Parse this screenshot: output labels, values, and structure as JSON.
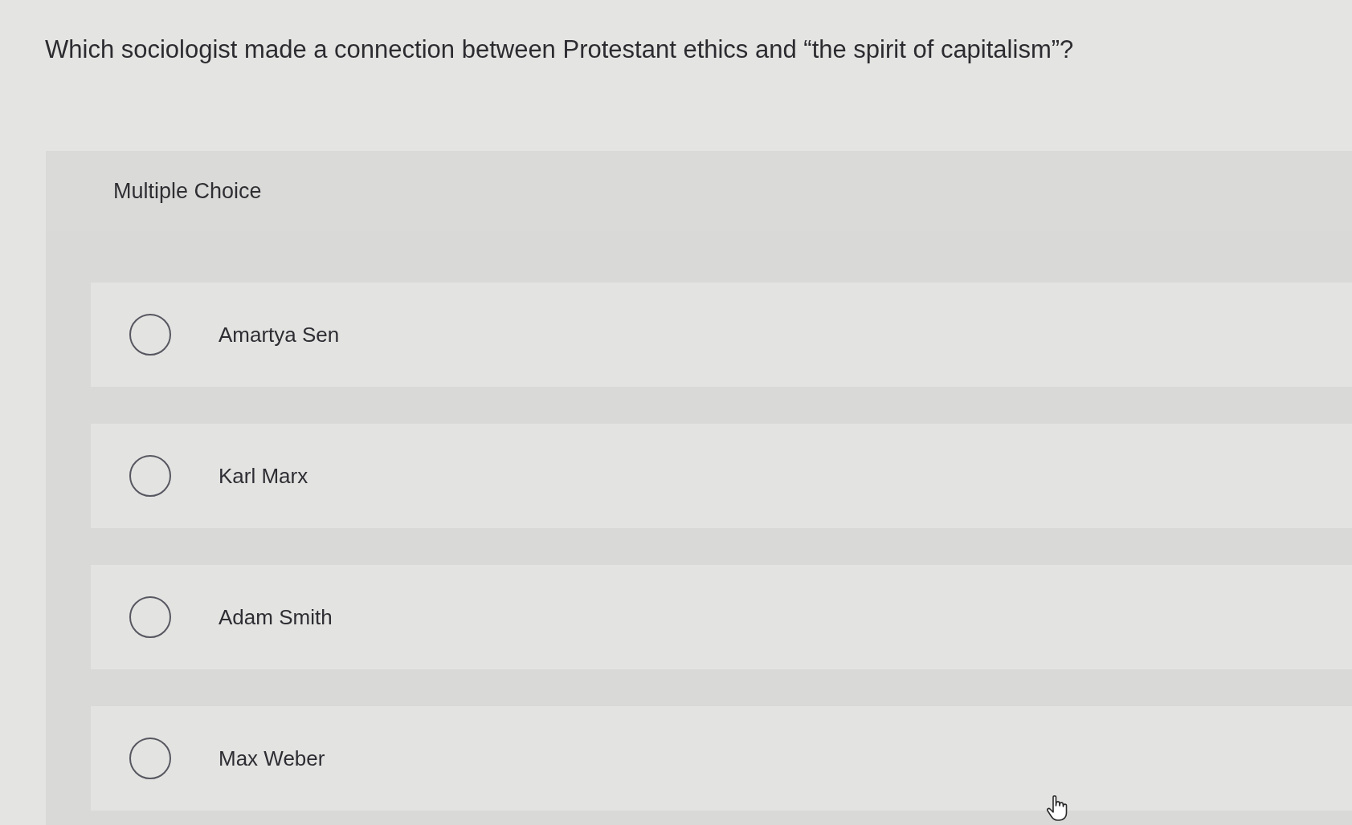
{
  "question": "Which sociologist made a connection between Protestant ethics and “the spirit of capitalism”?",
  "panel": {
    "heading": "Multiple Choice",
    "options": [
      {
        "label": "Amartya Sen",
        "selected": false
      },
      {
        "label": "Karl Marx",
        "selected": false
      },
      {
        "label": "Adam Smith",
        "selected": false
      },
      {
        "label": "Max Weber",
        "selected": false
      }
    ]
  }
}
